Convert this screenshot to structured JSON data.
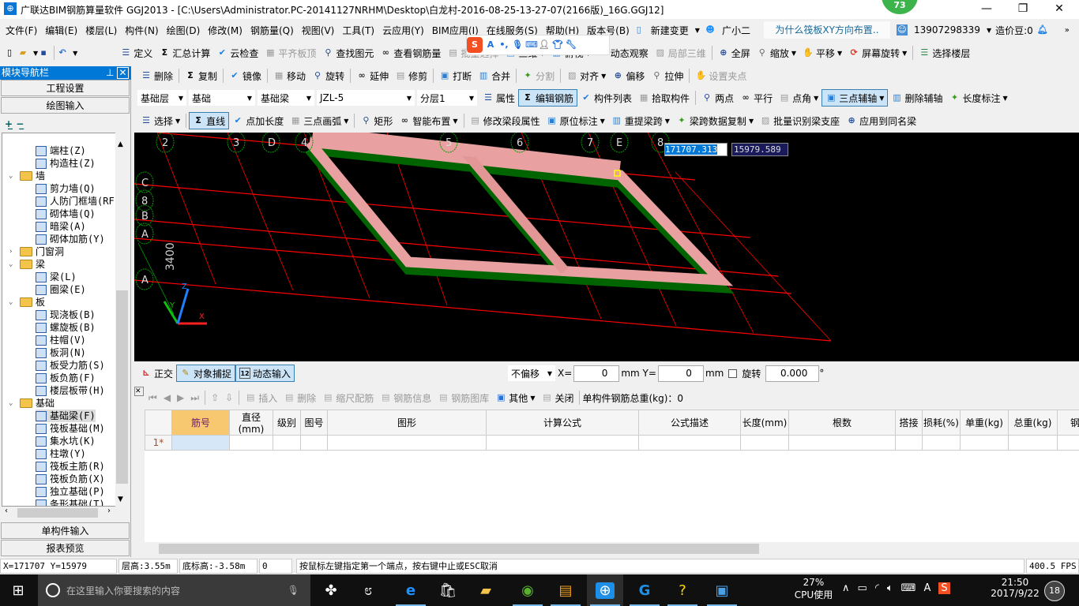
{
  "title": "广联达BIM钢筋算量软件 GGJ2013 - [C:\\Users\\Administrator.PC-20141127NRHM\\Desktop\\白龙村-2016-08-25-13-27-07(2166版)_16G.GGJ12]",
  "badge": "73",
  "menu": [
    "文件(F)",
    "编辑(E)",
    "楼层(L)",
    "构件(N)",
    "绘图(D)",
    "修改(M)",
    "钢筋量(Q)",
    "视图(V)",
    "工具(T)",
    "云应用(Y)",
    "BIM应用(I)",
    "在线服务(S)",
    "帮助(H)",
    "版本号(B)"
  ],
  "menu_right": {
    "new_change": "新建变更",
    "assistant": "广小二",
    "tip": "为什么筏板XY方向布置..",
    "phone": "13907298339",
    "beans": "造价豆:0"
  },
  "toolbar1": [
    "定义",
    "汇总计算",
    "云检查",
    "平齐板顶",
    "查找图元",
    "查看钢筋量",
    "批量选择",
    "三维",
    "俯视",
    "动态观察",
    "局部三维",
    "全屏",
    "缩放",
    "平移",
    "屏幕旋转",
    "选择楼层"
  ],
  "toolbar2": [
    "删除",
    "复制",
    "镜像",
    "移动",
    "旋转",
    "延伸",
    "修剪",
    "打断",
    "合并",
    "分割",
    "对齐",
    "偏移",
    "拉伸",
    "设置夹点"
  ],
  "toolbar3": {
    "combos": [
      "基础层",
      "基础",
      "基础梁",
      "JZL-5",
      "分层1"
    ],
    "items": [
      "属性",
      "编辑钢筋",
      "构件列表",
      "拾取构件",
      "两点",
      "平行",
      "点角",
      "三点辅轴",
      "删除辅轴",
      "长度标注"
    ]
  },
  "toolbar4": [
    "选择",
    "直线",
    "点加长度",
    "三点画弧",
    "矩形",
    "智能布置",
    "修改梁段属性",
    "原位标注",
    "重提梁跨",
    "梁跨数据复制",
    "批量识别梁支座",
    "应用到同名梁"
  ],
  "nav": {
    "title": "模块导航栏",
    "buttons": [
      "工程设置",
      "绘图输入"
    ],
    "bottom": [
      "单构件输入",
      "报表预览"
    ]
  },
  "tree": [
    {
      "label": "端柱(Z)",
      "lv": 2
    },
    {
      "label": "构造柱(Z)",
      "lv": 2
    },
    {
      "label": "墙",
      "lv": 1,
      "folder": true,
      "open": true
    },
    {
      "label": "剪力墙(Q)",
      "lv": 2
    },
    {
      "label": "人防门框墙(RF",
      "lv": 2
    },
    {
      "label": "砌体墙(Q)",
      "lv": 2
    },
    {
      "label": "暗梁(A)",
      "lv": 2
    },
    {
      "label": "砌体加筋(Y)",
      "lv": 2
    },
    {
      "label": "门窗洞",
      "lv": 1,
      "folder": true,
      "open": false
    },
    {
      "label": "梁",
      "lv": 1,
      "folder": true,
      "open": true
    },
    {
      "label": "梁(L)",
      "lv": 2
    },
    {
      "label": "圈梁(E)",
      "lv": 2
    },
    {
      "label": "板",
      "lv": 1,
      "folder": true,
      "open": true
    },
    {
      "label": "现浇板(B)",
      "lv": 2
    },
    {
      "label": "螺旋板(B)",
      "lv": 2
    },
    {
      "label": "柱帽(V)",
      "lv": 2
    },
    {
      "label": "板洞(N)",
      "lv": 2
    },
    {
      "label": "板受力筋(S)",
      "lv": 2
    },
    {
      "label": "板负筋(F)",
      "lv": 2
    },
    {
      "label": "楼层板带(H)",
      "lv": 2
    },
    {
      "label": "基础",
      "lv": 1,
      "folder": true,
      "open": true
    },
    {
      "label": "基础梁(F)",
      "lv": 2,
      "selected": true
    },
    {
      "label": "筏板基础(M)",
      "lv": 2
    },
    {
      "label": "集水坑(K)",
      "lv": 2
    },
    {
      "label": "柱墩(Y)",
      "lv": 2
    },
    {
      "label": "筏板主筋(R)",
      "lv": 2
    },
    {
      "label": "筏板负筋(X)",
      "lv": 2
    },
    {
      "label": "独立基础(P)",
      "lv": 2
    },
    {
      "label": "条形基础(T)",
      "lv": 2
    }
  ],
  "canvas": {
    "coord_x": "171707.313",
    "coord_y": "15979.589",
    "dim": "3400",
    "axes_top": [
      "2",
      "3",
      "D",
      "4",
      "5",
      "6",
      "7",
      "E",
      "8"
    ],
    "axes_left": [
      "C",
      "8",
      "B",
      "A",
      "A"
    ],
    "gizmo": [
      "X",
      "Y",
      "Z"
    ],
    "colors": {
      "grid": "#ff0000",
      "beam_top": "#e8a0a0",
      "beam_side": "#006400",
      "axis": "#00a000"
    }
  },
  "snapbar": {
    "ortho": "正交",
    "snap": "对象捕捉",
    "dyn": "动态输入",
    "offset": "不偏移",
    "x_label": "X=",
    "x": "0",
    "y_label": "Y=",
    "y": "0",
    "unit": "mm",
    "rotate": "旋转",
    "angle": "0.000",
    "deg": "°"
  },
  "rebar": {
    "toolbar": [
      "插入",
      "删除",
      "缩尺配筋",
      "钢筋信息",
      "钢筋图库",
      "其他",
      "关闭"
    ],
    "total": "单构件钢筋总重(kg)：0",
    "columns": [
      "筋号",
      "直径(mm)",
      "级别",
      "图号",
      "图形",
      "计算公式",
      "公式描述",
      "长度(mm)",
      "根数",
      "搭接",
      "损耗(%)",
      "单重(kg)",
      "总重(kg)",
      "钢"
    ],
    "row_label": "1*"
  },
  "status": {
    "coords": "X=171707 Y=15979",
    "floor_h": "层高:3.55m",
    "bottom_h": "底标高:-3.58m",
    "val": "0",
    "hint": "按鼠标左键指定第一个端点，按右键中止或ESC取消",
    "fps": "400.5 FPS"
  },
  "taskbar": {
    "search": "在这里输入你要搜索的内容",
    "cpu": "27%",
    "cpu_label": "CPU使用",
    "time": "21:50",
    "date": "2017/9/22",
    "notif": "18"
  }
}
